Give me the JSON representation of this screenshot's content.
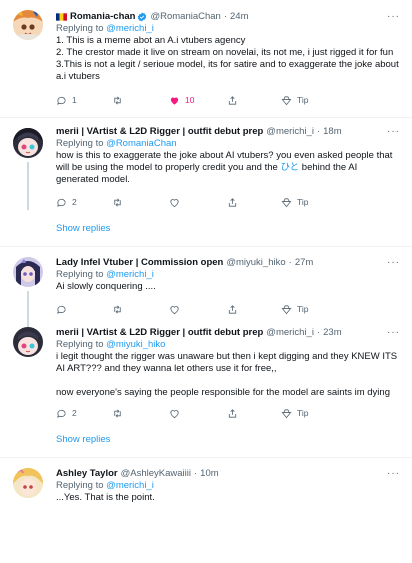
{
  "colors": {
    "accent": "#1d9bf0",
    "like": "#f91880",
    "muted": "#536471",
    "text": "#0f1419"
  },
  "tweets": [
    {
      "name": "Romania-chan",
      "handle": "@RomaniaChan",
      "time": "24m",
      "replying_label": "Replying to ",
      "replying_to": "@merichi_i",
      "body": "1. This is a meme abot an A.i vtubers agency\n2. The crestor made it live on stream on novelai, its not me, i just rigged it for fun\n3.This is not a legit / serioue model, its for satire and to exaggerate the joke about a.i vtubers",
      "replies": "1",
      "retweets": "",
      "likes": "10",
      "tip": "Tip"
    },
    {
      "name": "merii | VArtist & L2D Rigger | outfit debut prep",
      "handle": "@merichi_i",
      "time": "18m",
      "replying_label": "Replying to ",
      "replying_to": "@RomaniaChan",
      "body_pre": "how is this to exaggerate the joke about AI vtubers? you even asked people that will be using the model to properly credit you and the ",
      "body_hl": "ひと",
      "body_post": " behind the AI generated model.",
      "replies": "2",
      "retweets": "",
      "likes": "",
      "tip": "Tip"
    },
    {
      "name": "Lady Infel Vtuber | Commission open",
      "handle": "@miyuki_hiko",
      "time": "27m",
      "replying_label": "Replying to ",
      "replying_to": "@merichi_i",
      "body": "Ai slowly conquering ....",
      "replies": "",
      "retweets": "",
      "likes": "",
      "tip": "Tip"
    },
    {
      "name": "merii | VArtist & L2D Rigger | outfit debut prep",
      "handle": "@merichi_i",
      "time": "23m",
      "replying_label": "Replying to ",
      "replying_to": "@miyuki_hiko",
      "body": "i legit thought the rigger was unaware but then i kept digging and they KNEW ITS AI ART??? and they wanna let others use it for free,,\n\nnow everyone's saying the people responsible for the model are saints im dying",
      "replies": "2",
      "retweets": "",
      "likes": "",
      "tip": "Tip"
    },
    {
      "name": "Ashley Taylor",
      "handle": "@AshleyKawaiiii",
      "time": "10m",
      "replying_label": "Replying to ",
      "replying_to": "@merichi_i",
      "body": "...Yes. That is the point."
    }
  ],
  "show_replies": "Show replies",
  "dot": "·",
  "more": "···"
}
